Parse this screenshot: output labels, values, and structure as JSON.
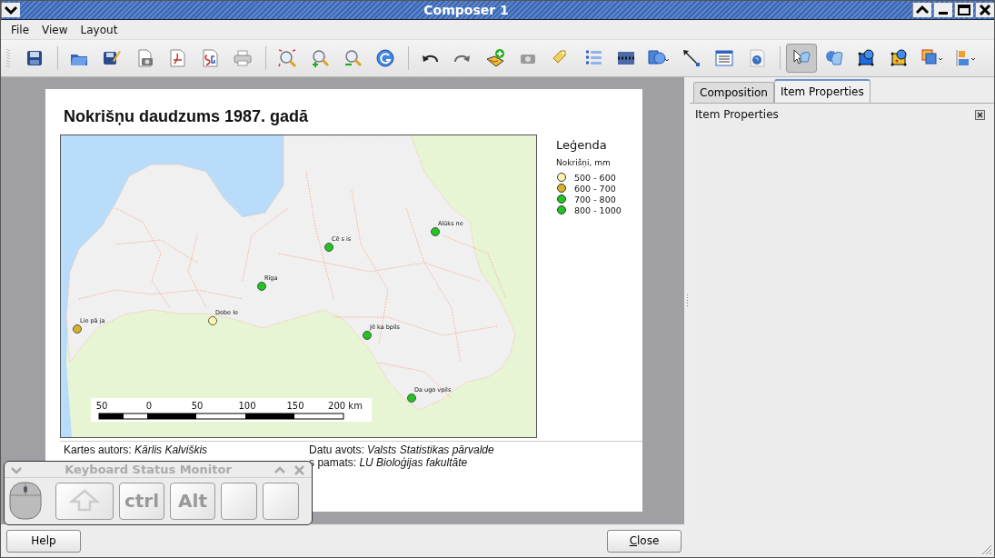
{
  "window": {
    "title": "Composer 1"
  },
  "menu": [
    "File",
    "View",
    "Layout"
  ],
  "toolbar": {
    "mode_tools": [
      {
        "selected": true
      },
      {
        "selected": false
      },
      {
        "selected": false
      },
      {
        "selected": false
      }
    ]
  },
  "page": {
    "title": "Nokrišņu daudzums 1987. gadā",
    "map": {
      "cities": [
        {
          "name": "Alūks ne",
          "color": "#22c422"
        },
        {
          "name": "Cē s is",
          "color": "#22c422"
        },
        {
          "name": "Rīga",
          "color": "#22c422"
        },
        {
          "name": "Dobe le",
          "color": "#fff7b0"
        },
        {
          "name": "Lie pā ja",
          "color": "#d9b22a"
        },
        {
          "name": "Jē ka bpils",
          "color": "#22c422"
        },
        {
          "name": "Da ugo vpils",
          "color": "#22c422"
        }
      ],
      "scale_labels": [
        "50",
        "0",
        "50",
        "100",
        "150",
        "200 km"
      ]
    },
    "legend": {
      "title": "Leģenda",
      "subtitle": "Nokrišņi, mm",
      "items": [
        {
          "label": "500 - 600",
          "color": "#fff7b0"
        },
        {
          "label": "600 - 700",
          "color": "#d9b22a"
        },
        {
          "label": "700 - 800",
          "color": "#22c422"
        },
        {
          "label": "800 - 1000",
          "color": "#22c422"
        }
      ]
    },
    "credits_left": "Kartes autors: *Kārlis Kalviškis*",
    "credits_right": [
      "Datu avots: *Valsts Statistikas pārvalde*",
      "s pamats: *LU Bioloģijas fakultāte*"
    ]
  },
  "panel": {
    "tabs": [
      {
        "label": "Composition",
        "selected": false
      },
      {
        "label": "Item Properties",
        "selected": true
      }
    ],
    "header": "Item Properties"
  },
  "buttons": {
    "help": "Help",
    "close": "Close"
  },
  "monitor": {
    "title": "Keyboard Status Monitor",
    "keys": [
      {
        "kind": "shift",
        "active": false
      },
      {
        "kind": "text",
        "label": "ctrl",
        "active": false
      },
      {
        "kind": "text",
        "label": "Alt",
        "active": false
      },
      {
        "kind": "blank",
        "active": false
      },
      {
        "kind": "blank",
        "active": false
      }
    ]
  }
}
